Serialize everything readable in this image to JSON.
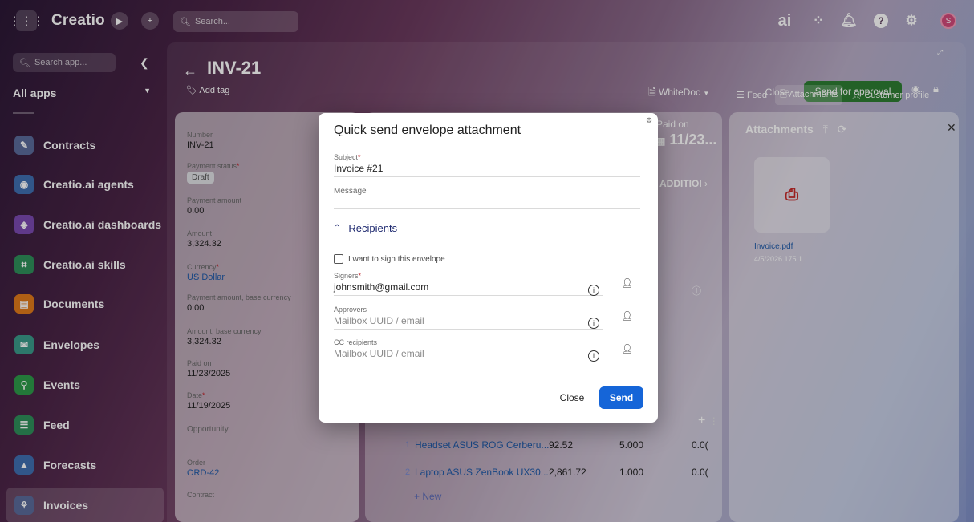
{
  "topbar": {
    "app_name": "Creatio",
    "search_placeholder": "Search...",
    "ai_label": "ai",
    "avatar_initial": "S"
  },
  "sidebar": {
    "search_placeholder": "Search app...",
    "section_label": "All apps",
    "items": [
      {
        "label": "Contracts",
        "color": "#5a6b9a"
      },
      {
        "label": "Creatio.ai agents",
        "color": "#3f6fb0"
      },
      {
        "label": "Creatio.ai dashboards",
        "color": "#7a4ab0"
      },
      {
        "label": "Creatio.ai skills",
        "color": "#2f8f5a"
      },
      {
        "label": "Documents",
        "color": "#e07a1a"
      },
      {
        "label": "Envelopes",
        "color": "#3a9a8a"
      },
      {
        "label": "Events",
        "color": "#2e9a4a"
      },
      {
        "label": "Feed",
        "color": "#2f8f5a"
      },
      {
        "label": "Forecasts",
        "color": "#3f6fb0"
      },
      {
        "label": "Invoices",
        "color": "#5a6b9a"
      }
    ]
  },
  "page": {
    "title": "INV-21",
    "add_tag": "Add tag",
    "close_label": "Close",
    "send_for_approval": "Send for approval",
    "send_color": "#2e7d32",
    "whitedoc": "WhiteDoc",
    "tabs": {
      "feed": "Feed",
      "attachments": "Attachments",
      "customer_profile": "Customer profile"
    },
    "paid_on_label": "Paid on",
    "paid_on_value": "11/23...",
    "addition_tab": "ADDITIOI"
  },
  "fields": {
    "number": {
      "label": "Number",
      "value": "INV-21"
    },
    "payment_status": {
      "label": "Payment status",
      "value": "Draft"
    },
    "payment_amount": {
      "label": "Payment amount",
      "value": "0.00"
    },
    "amount": {
      "label": "Amount",
      "value": "3,324.32"
    },
    "currency": {
      "label": "Currency",
      "value": "US Dollar"
    },
    "payment_amount_base": {
      "label": "Payment amount, base currency",
      "value": "0.00"
    },
    "amount_base": {
      "label": "Amount, base currency",
      "value": "3,324.32"
    },
    "paid_on": {
      "label": "Paid on",
      "value": "11/23/2025"
    },
    "date": {
      "label": "Date",
      "value": "11/19/2025"
    },
    "opportunity": {
      "label": "Opportunity",
      "value": ""
    },
    "order": {
      "label": "Order",
      "value": "ORD-42"
    },
    "contract": {
      "label": "Contract",
      "value": ""
    }
  },
  "products": [
    {
      "num": "1",
      "name": "Headset ASUS ROG Cerberu...",
      "price": "92.52",
      "qty": "5.000",
      "disc": "0.0("
    },
    {
      "num": "2",
      "name": "Laptop ASUS ZenBook UX30...",
      "price": "2,861.72",
      "qty": "1.000",
      "disc": "0.0("
    }
  ],
  "new_label": "+ New",
  "attachments": {
    "title": "Attachments",
    "file_name": "Invoice.pdf",
    "file_meta": "4/5/2026   175.1..."
  },
  "modal": {
    "title": "Quick send envelope attachment",
    "subject_label": "Subject",
    "subject_value": "Invoice #21",
    "message_label": "Message",
    "recipients_label": "Recipients",
    "sign_checkbox": "I want to sign this envelope",
    "signers_label": "Signers",
    "signers_value": "johnsmith@gmail.com",
    "approvers_label": "Approvers",
    "approvers_placeholder": "Mailbox UUID / email",
    "cc_label": "CC recipients",
    "cc_placeholder": "Mailbox UUID / email",
    "close_label": "Close",
    "send_label": "Send"
  }
}
